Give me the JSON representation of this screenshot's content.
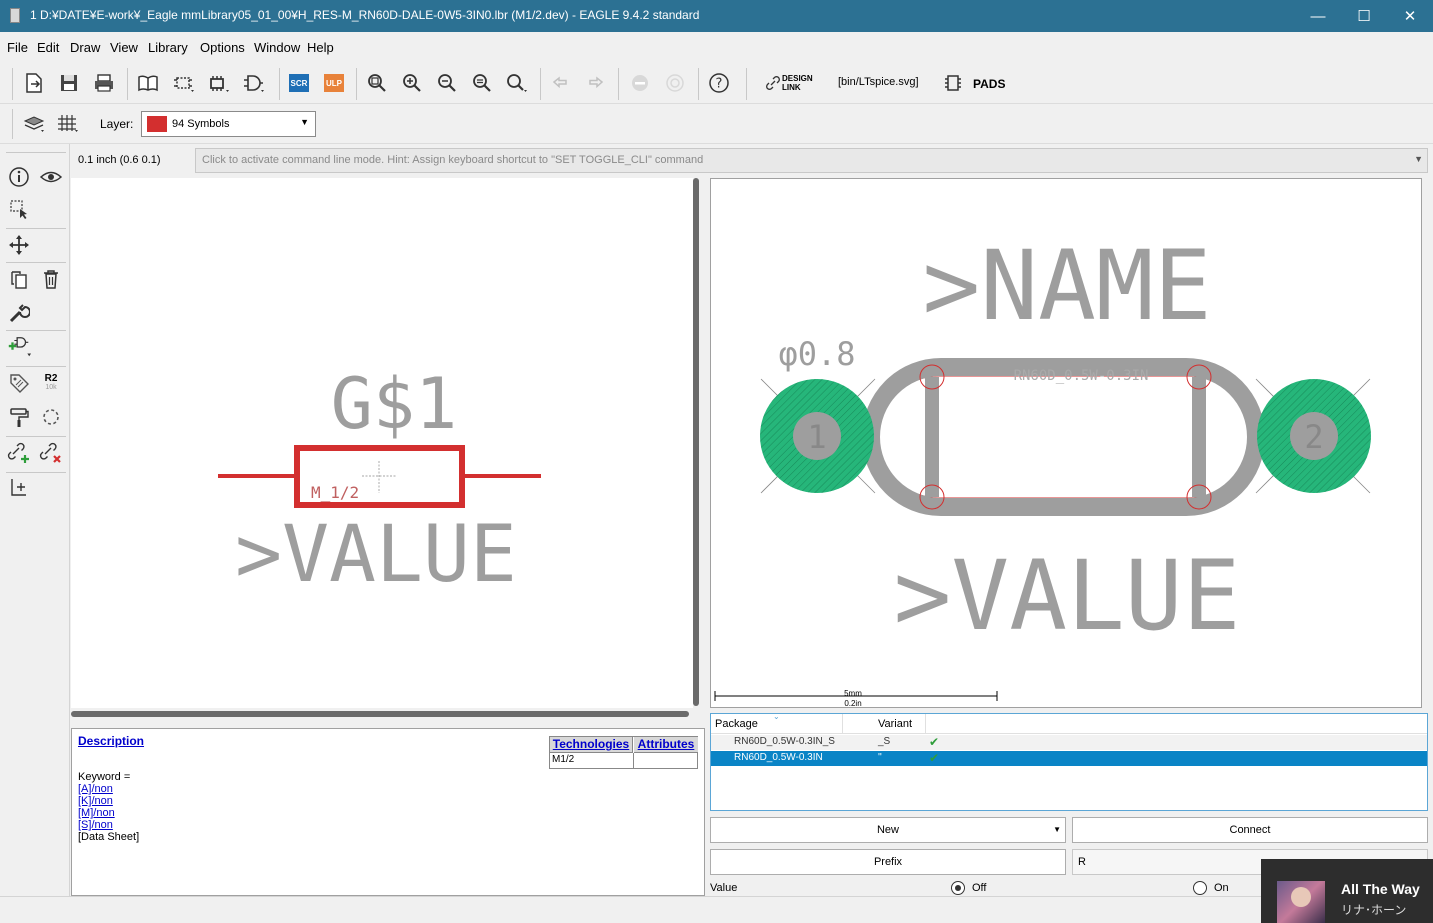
{
  "window": {
    "title": "1 D:¥DATE¥E-work¥_Eagle mmLibrary05_01_00¥H_RES-M_RN60D-DALE-0W5-3IN0.lbr (M1/2.dev) - EAGLE 9.4.2 standard",
    "minimize": "—",
    "maximize": "☐",
    "close": "✕"
  },
  "menu": [
    "File",
    "Edit",
    "Draw",
    "View",
    "Library",
    "Options",
    "Window",
    "Help"
  ],
  "toolbar": {
    "scr": "SCR",
    "ulp": "ULP",
    "design_link_1": "DESIGN",
    "design_link_2": "LINK",
    "ltspice": "[bin/LTspice.svg]",
    "pads": "PADS"
  },
  "layerbar": {
    "label": "Layer:",
    "value": "94 Symbols",
    "color": "#d32f2f"
  },
  "command": {
    "grid": "0.1 inch (0.6 0.1)",
    "hint": "Click to activate command line mode. Hint: Assign keyboard shortcut to \"SET TOGGLE_CLI\" command"
  },
  "leftbar": {
    "r2": "R2",
    "r2sub": "10k"
  },
  "symbol": {
    "gate_name": "G$1",
    "symbol_label": "M_1/2",
    "value": ">VALUE",
    "body_color": "#d32f2f",
    "text_color": "#9e9e9e"
  },
  "package": {
    "name": ">NAME",
    "value": ">VALUE",
    "drill": "φ0.8",
    "silk_name": "RN60D_0.5W-0.3IN",
    "pad1": "1",
    "pad2": "2",
    "scale_top": "5mm",
    "scale_bottom": "0.2in",
    "pad_color": "#26b67a"
  },
  "description": {
    "heading": "Description",
    "tabs": [
      "Technologies",
      "Attributes"
    ],
    "tech_value": "M1/2",
    "keyword": "Keyword =",
    "links": [
      "[A]/non",
      "[K]/non",
      "[M]/non",
      "[S]/non"
    ],
    "datasheet": "[Data Sheet]"
  },
  "pkgtable": {
    "headers": [
      "Package",
      "Variant"
    ],
    "rows": [
      {
        "package": "RN60D_0.5W-0.3IN_S",
        "variant": "_S",
        "check": "✔"
      },
      {
        "package": "RN60D_0.5W-0.3IN",
        "variant": "''",
        "check": "✔"
      }
    ]
  },
  "buttons": {
    "new": "New",
    "connect": "Connect",
    "prefix": "Prefix",
    "prefix_value": "R"
  },
  "value_row": {
    "label": "Value",
    "off": "Off",
    "on": "On"
  },
  "toast": {
    "title": "All The Way",
    "artist": "リナ･ホーン"
  }
}
